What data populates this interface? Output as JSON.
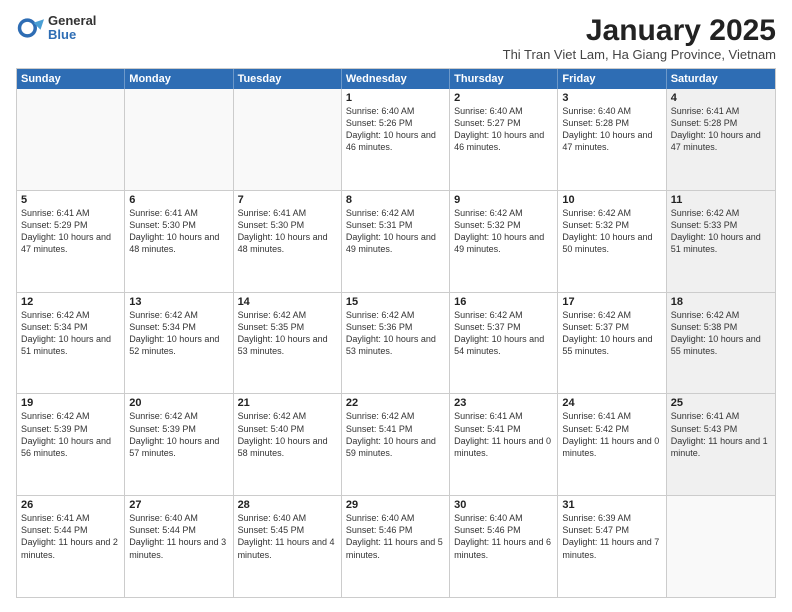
{
  "logo": {
    "general": "General",
    "blue": "Blue"
  },
  "title": "January 2025",
  "subtitle": "Thi Tran Viet Lam, Ha Giang Province, Vietnam",
  "headers": [
    "Sunday",
    "Monday",
    "Tuesday",
    "Wednesday",
    "Thursday",
    "Friday",
    "Saturday"
  ],
  "weeks": [
    [
      {
        "day": "",
        "sunrise": "",
        "sunset": "",
        "daylight": "",
        "shaded": false,
        "empty": true
      },
      {
        "day": "",
        "sunrise": "",
        "sunset": "",
        "daylight": "",
        "shaded": false,
        "empty": true
      },
      {
        "day": "",
        "sunrise": "",
        "sunset": "",
        "daylight": "",
        "shaded": false,
        "empty": true
      },
      {
        "day": "1",
        "sunrise": "Sunrise: 6:40 AM",
        "sunset": "Sunset: 5:26 PM",
        "daylight": "Daylight: 10 hours and 46 minutes.",
        "shaded": false,
        "empty": false
      },
      {
        "day": "2",
        "sunrise": "Sunrise: 6:40 AM",
        "sunset": "Sunset: 5:27 PM",
        "daylight": "Daylight: 10 hours and 46 minutes.",
        "shaded": false,
        "empty": false
      },
      {
        "day": "3",
        "sunrise": "Sunrise: 6:40 AM",
        "sunset": "Sunset: 5:28 PM",
        "daylight": "Daylight: 10 hours and 47 minutes.",
        "shaded": false,
        "empty": false
      },
      {
        "day": "4",
        "sunrise": "Sunrise: 6:41 AM",
        "sunset": "Sunset: 5:28 PM",
        "daylight": "Daylight: 10 hours and 47 minutes.",
        "shaded": true,
        "empty": false
      }
    ],
    [
      {
        "day": "5",
        "sunrise": "Sunrise: 6:41 AM",
        "sunset": "Sunset: 5:29 PM",
        "daylight": "Daylight: 10 hours and 47 minutes.",
        "shaded": false,
        "empty": false
      },
      {
        "day": "6",
        "sunrise": "Sunrise: 6:41 AM",
        "sunset": "Sunset: 5:30 PM",
        "daylight": "Daylight: 10 hours and 48 minutes.",
        "shaded": false,
        "empty": false
      },
      {
        "day": "7",
        "sunrise": "Sunrise: 6:41 AM",
        "sunset": "Sunset: 5:30 PM",
        "daylight": "Daylight: 10 hours and 48 minutes.",
        "shaded": false,
        "empty": false
      },
      {
        "day": "8",
        "sunrise": "Sunrise: 6:42 AM",
        "sunset": "Sunset: 5:31 PM",
        "daylight": "Daylight: 10 hours and 49 minutes.",
        "shaded": false,
        "empty": false
      },
      {
        "day": "9",
        "sunrise": "Sunrise: 6:42 AM",
        "sunset": "Sunset: 5:32 PM",
        "daylight": "Daylight: 10 hours and 49 minutes.",
        "shaded": false,
        "empty": false
      },
      {
        "day": "10",
        "sunrise": "Sunrise: 6:42 AM",
        "sunset": "Sunset: 5:32 PM",
        "daylight": "Daylight: 10 hours and 50 minutes.",
        "shaded": false,
        "empty": false
      },
      {
        "day": "11",
        "sunrise": "Sunrise: 6:42 AM",
        "sunset": "Sunset: 5:33 PM",
        "daylight": "Daylight: 10 hours and 51 minutes.",
        "shaded": true,
        "empty": false
      }
    ],
    [
      {
        "day": "12",
        "sunrise": "Sunrise: 6:42 AM",
        "sunset": "Sunset: 5:34 PM",
        "daylight": "Daylight: 10 hours and 51 minutes.",
        "shaded": false,
        "empty": false
      },
      {
        "day": "13",
        "sunrise": "Sunrise: 6:42 AM",
        "sunset": "Sunset: 5:34 PM",
        "daylight": "Daylight: 10 hours and 52 minutes.",
        "shaded": false,
        "empty": false
      },
      {
        "day": "14",
        "sunrise": "Sunrise: 6:42 AM",
        "sunset": "Sunset: 5:35 PM",
        "daylight": "Daylight: 10 hours and 53 minutes.",
        "shaded": false,
        "empty": false
      },
      {
        "day": "15",
        "sunrise": "Sunrise: 6:42 AM",
        "sunset": "Sunset: 5:36 PM",
        "daylight": "Daylight: 10 hours and 53 minutes.",
        "shaded": false,
        "empty": false
      },
      {
        "day": "16",
        "sunrise": "Sunrise: 6:42 AM",
        "sunset": "Sunset: 5:37 PM",
        "daylight": "Daylight: 10 hours and 54 minutes.",
        "shaded": false,
        "empty": false
      },
      {
        "day": "17",
        "sunrise": "Sunrise: 6:42 AM",
        "sunset": "Sunset: 5:37 PM",
        "daylight": "Daylight: 10 hours and 55 minutes.",
        "shaded": false,
        "empty": false
      },
      {
        "day": "18",
        "sunrise": "Sunrise: 6:42 AM",
        "sunset": "Sunset: 5:38 PM",
        "daylight": "Daylight: 10 hours and 55 minutes.",
        "shaded": true,
        "empty": false
      }
    ],
    [
      {
        "day": "19",
        "sunrise": "Sunrise: 6:42 AM",
        "sunset": "Sunset: 5:39 PM",
        "daylight": "Daylight: 10 hours and 56 minutes.",
        "shaded": false,
        "empty": false
      },
      {
        "day": "20",
        "sunrise": "Sunrise: 6:42 AM",
        "sunset": "Sunset: 5:39 PM",
        "daylight": "Daylight: 10 hours and 57 minutes.",
        "shaded": false,
        "empty": false
      },
      {
        "day": "21",
        "sunrise": "Sunrise: 6:42 AM",
        "sunset": "Sunset: 5:40 PM",
        "daylight": "Daylight: 10 hours and 58 minutes.",
        "shaded": false,
        "empty": false
      },
      {
        "day": "22",
        "sunrise": "Sunrise: 6:42 AM",
        "sunset": "Sunset: 5:41 PM",
        "daylight": "Daylight: 10 hours and 59 minutes.",
        "shaded": false,
        "empty": false
      },
      {
        "day": "23",
        "sunrise": "Sunrise: 6:41 AM",
        "sunset": "Sunset: 5:41 PM",
        "daylight": "Daylight: 11 hours and 0 minutes.",
        "shaded": false,
        "empty": false
      },
      {
        "day": "24",
        "sunrise": "Sunrise: 6:41 AM",
        "sunset": "Sunset: 5:42 PM",
        "daylight": "Daylight: 11 hours and 0 minutes.",
        "shaded": false,
        "empty": false
      },
      {
        "day": "25",
        "sunrise": "Sunrise: 6:41 AM",
        "sunset": "Sunset: 5:43 PM",
        "daylight": "Daylight: 11 hours and 1 minute.",
        "shaded": true,
        "empty": false
      }
    ],
    [
      {
        "day": "26",
        "sunrise": "Sunrise: 6:41 AM",
        "sunset": "Sunset: 5:44 PM",
        "daylight": "Daylight: 11 hours and 2 minutes.",
        "shaded": false,
        "empty": false
      },
      {
        "day": "27",
        "sunrise": "Sunrise: 6:40 AM",
        "sunset": "Sunset: 5:44 PM",
        "daylight": "Daylight: 11 hours and 3 minutes.",
        "shaded": false,
        "empty": false
      },
      {
        "day": "28",
        "sunrise": "Sunrise: 6:40 AM",
        "sunset": "Sunset: 5:45 PM",
        "daylight": "Daylight: 11 hours and 4 minutes.",
        "shaded": false,
        "empty": false
      },
      {
        "day": "29",
        "sunrise": "Sunrise: 6:40 AM",
        "sunset": "Sunset: 5:46 PM",
        "daylight": "Daylight: 11 hours and 5 minutes.",
        "shaded": false,
        "empty": false
      },
      {
        "day": "30",
        "sunrise": "Sunrise: 6:40 AM",
        "sunset": "Sunset: 5:46 PM",
        "daylight": "Daylight: 11 hours and 6 minutes.",
        "shaded": false,
        "empty": false
      },
      {
        "day": "31",
        "sunrise": "Sunrise: 6:39 AM",
        "sunset": "Sunset: 5:47 PM",
        "daylight": "Daylight: 11 hours and 7 minutes.",
        "shaded": false,
        "empty": false
      },
      {
        "day": "",
        "sunrise": "",
        "sunset": "",
        "daylight": "",
        "shaded": true,
        "empty": true
      }
    ]
  ]
}
